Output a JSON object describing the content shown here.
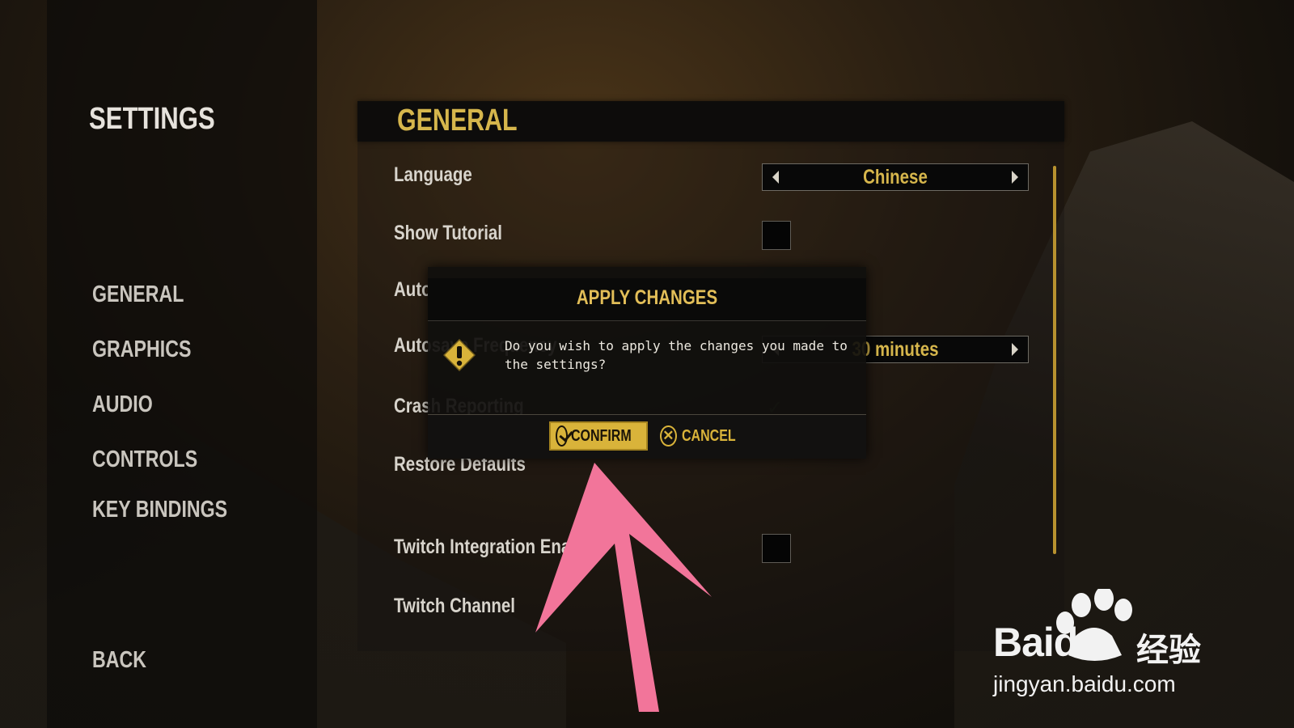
{
  "sidebar": {
    "title": "SETTINGS",
    "nav": [
      "GENERAL",
      "GRAPHICS",
      "AUDIO",
      "CONTROLS",
      "KEY BINDINGS"
    ],
    "back": "BACK"
  },
  "panel": {
    "title": "GENERAL",
    "rows": {
      "language": {
        "label": "Language",
        "value": "Chinese"
      },
      "show_tutorial": {
        "label": "Show Tutorial",
        "checked": false
      },
      "autosave": {
        "label": "Autosave"
      },
      "autosave_frequency": {
        "label": "Autosave Frequency",
        "value": "30 minutes"
      },
      "crash_reporting": {
        "label": "Crash Reporting",
        "checked": true
      },
      "restore_defaults": {
        "label": "Restore Defaults"
      },
      "twitch_integration": {
        "label": "Twitch Integration Enabled",
        "checked": false
      },
      "twitch_channel": {
        "label": "Twitch Channel"
      }
    }
  },
  "dialog": {
    "title": "APPLY CHANGES",
    "message": "Do you wish to apply the changes you made to the settings?",
    "confirm": "CONFIRM",
    "cancel": "CANCEL",
    "cancel_icon_glyph": "✕"
  },
  "watermark": {
    "brand": "Baidu",
    "cn": "经验",
    "url": "jingyan.baidu.com"
  },
  "colors": {
    "accent_gold": "#d6b64c",
    "annotation_pink": "#f2759a"
  },
  "icons": {
    "selector_left": "triangle-left-icon",
    "selector_right": "triangle-right-icon",
    "dialog_warning": "warning-diamond-icon",
    "confirm": "check-circle-icon",
    "cancel": "x-circle-icon"
  }
}
